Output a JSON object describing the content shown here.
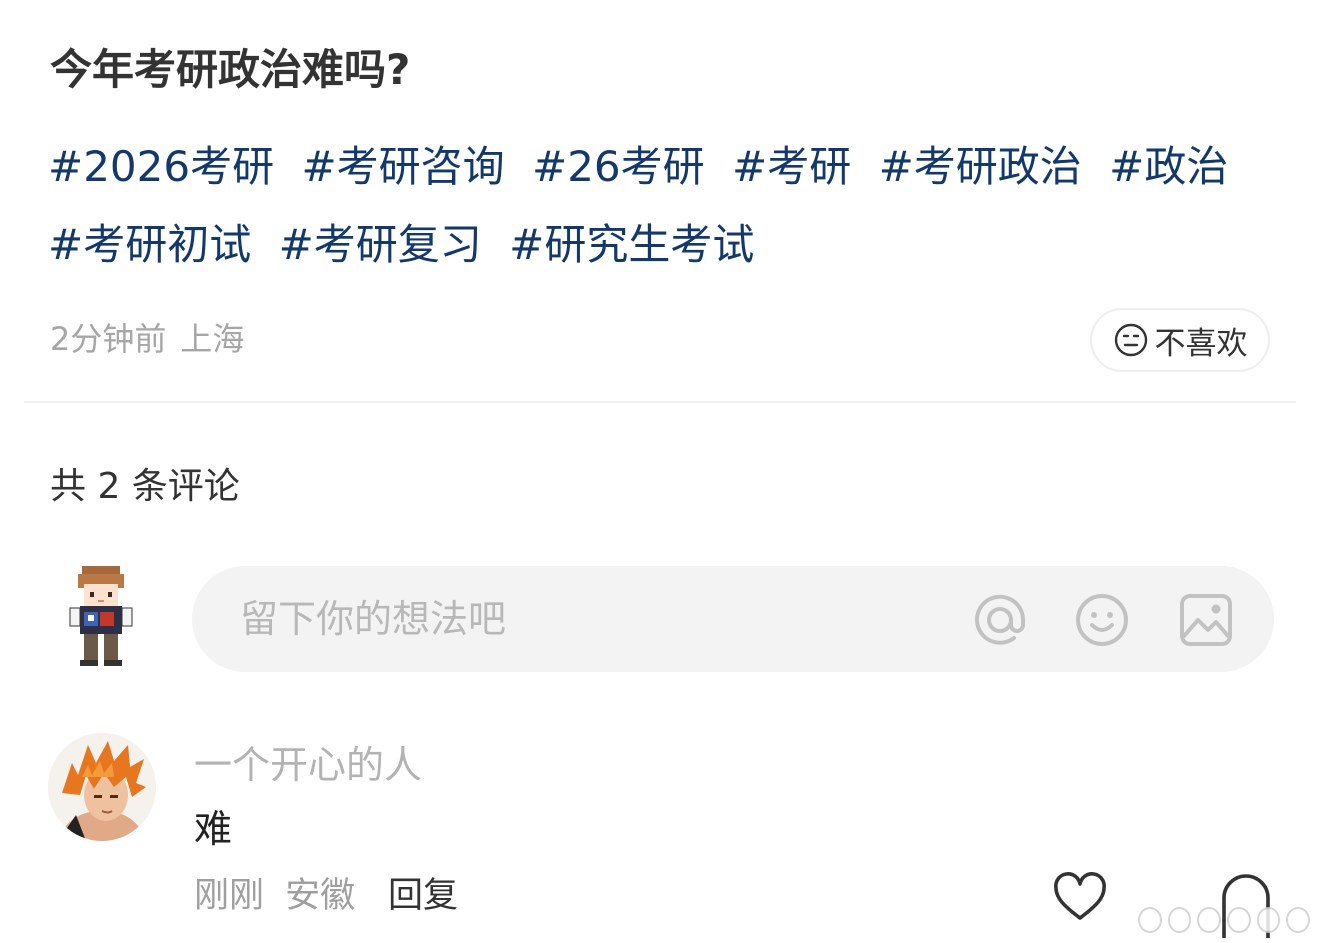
{
  "post": {
    "title": "今年考研政治难吗?",
    "tags": [
      "#2026考研",
      "#考研咨询",
      "#26考研",
      "#考研",
      "#考研政治",
      "#政治",
      "#考研初试",
      "#考研复习",
      "#研究生考试"
    ],
    "time": "2分钟前",
    "location": "上海",
    "dislike_label": "不喜欢"
  },
  "comments_section": {
    "count_label": "共 2 条评论",
    "input": {
      "placeholder": "留下你的想法吧",
      "icons": [
        "at-icon",
        "emoji-icon",
        "image-icon"
      ]
    },
    "comments": [
      {
        "username": "一个开心的人",
        "text": "难",
        "time": "刚刚",
        "location": "安徽",
        "reply_label": "回复"
      }
    ]
  },
  "colors": {
    "tag": "#13386c",
    "meta": "#a6a6a6",
    "input_bg": "#f3f3f3",
    "icon_gray": "#c2c2c2"
  }
}
